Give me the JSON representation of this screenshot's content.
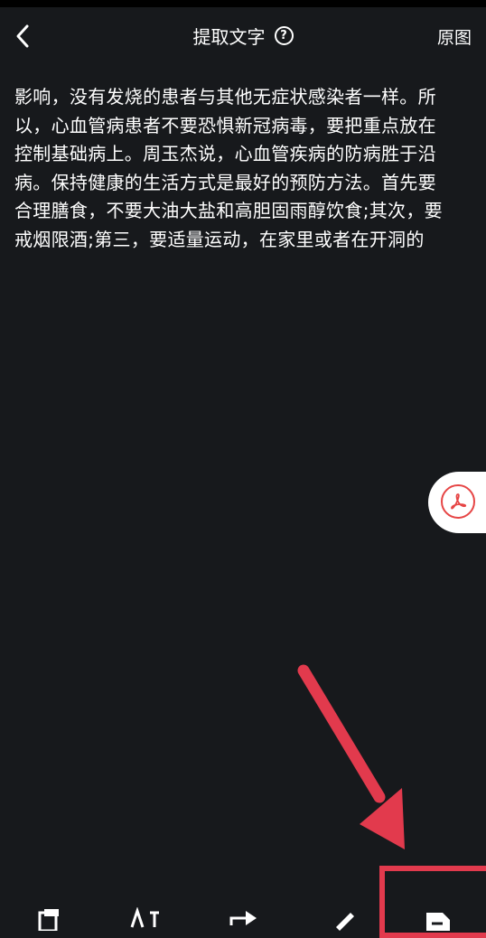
{
  "header": {
    "title": "提取文字",
    "help_glyph": "?",
    "original_label": "原图"
  },
  "content": {
    "text": "影响，没有发烧的患者与其他无症状感染者一样。所\n以，心血管病患者不要恐惧新冠病毒，要把重点放在\n控制基础病上。周玉杰说，心血管疾病的防病胜于沿\n病。保持健康的生活方式是最好的预防方法。首先要\n合理膳食，不要大油大盐和高胆固雨醇饮食;其次，要\n戒烟限酒;第三，要适量运动，在家里或者在开洞的"
  },
  "float_button": {
    "icon": "pdf-icon",
    "accent": "#e64545"
  },
  "annotation": {
    "color": "#e23a4d"
  },
  "toolbar": {
    "icons": [
      "copy-icon",
      "translate-icon",
      "share-icon",
      "edit-icon",
      "export-document-icon"
    ]
  }
}
